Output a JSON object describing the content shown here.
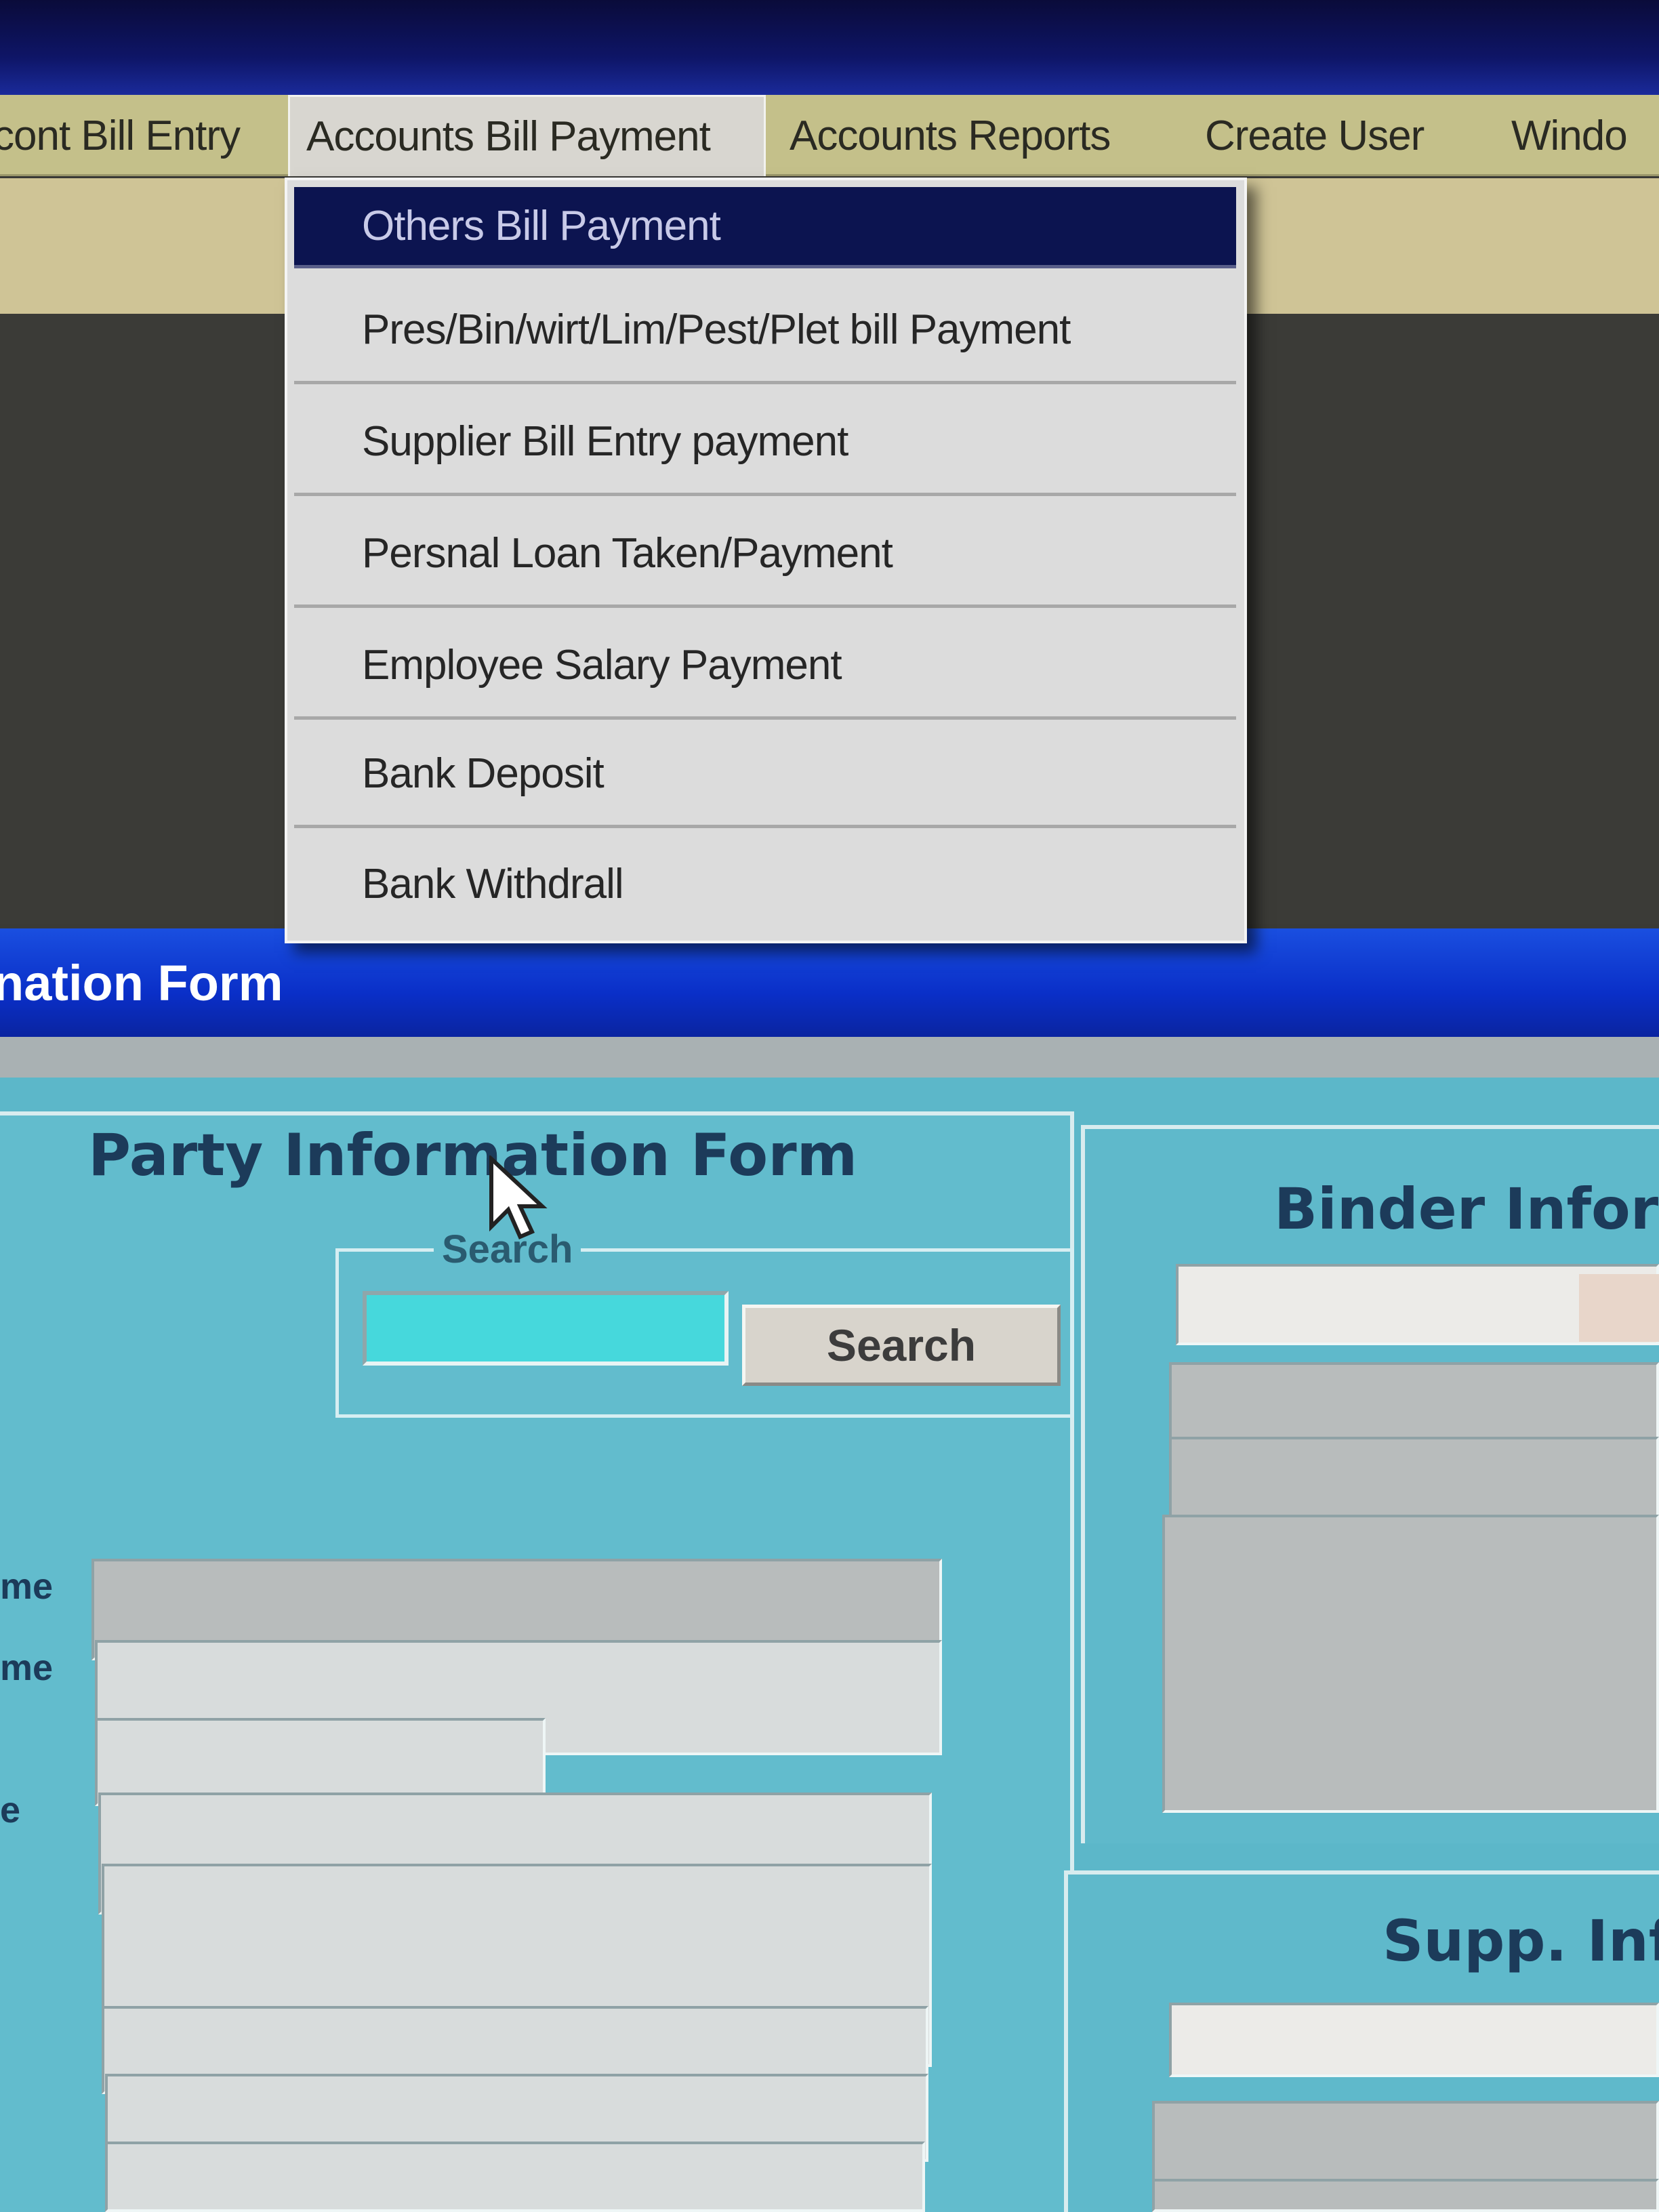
{
  "menubar": {
    "items": [
      {
        "label": "cont  Bill Entry"
      },
      {
        "label": "Accounts Bill Payment"
      },
      {
        "label": "Accounts Reports"
      },
      {
        "label": "Create User"
      },
      {
        "label": "Windo"
      }
    ]
  },
  "dropdown": {
    "items": [
      {
        "label": "Others Bill Payment"
      },
      {
        "label": "Pres/Bin/wirt/Lim/Pest/Plet bill Payment"
      },
      {
        "label": "Supplier Bill Entry payment"
      },
      {
        "label": "Persnal Loan Taken/Payment"
      },
      {
        "label": "Employee Salary Payment"
      },
      {
        "label": "Bank Deposit"
      },
      {
        "label": "Bank Withdrall"
      }
    ],
    "highlighted_index": 0
  },
  "window": {
    "title": "nation Form"
  },
  "party_form": {
    "title": "Party Information Form",
    "search_group_label": "Search",
    "search_value": "",
    "search_button": "Search",
    "side_labels": [
      "me",
      "me",
      "e"
    ]
  },
  "binder": {
    "title": "Binder Infor"
  },
  "supp": {
    "title": "Supp. Inf"
  },
  "colors": {
    "menubar": "#c4c08a",
    "highlight": "#0c1450",
    "title_bar": "#0a2fc8",
    "form_bg": "#5cb7c9",
    "search_input": "#46d8dc"
  },
  "icons": [
    "mouse-pointer-icon"
  ]
}
